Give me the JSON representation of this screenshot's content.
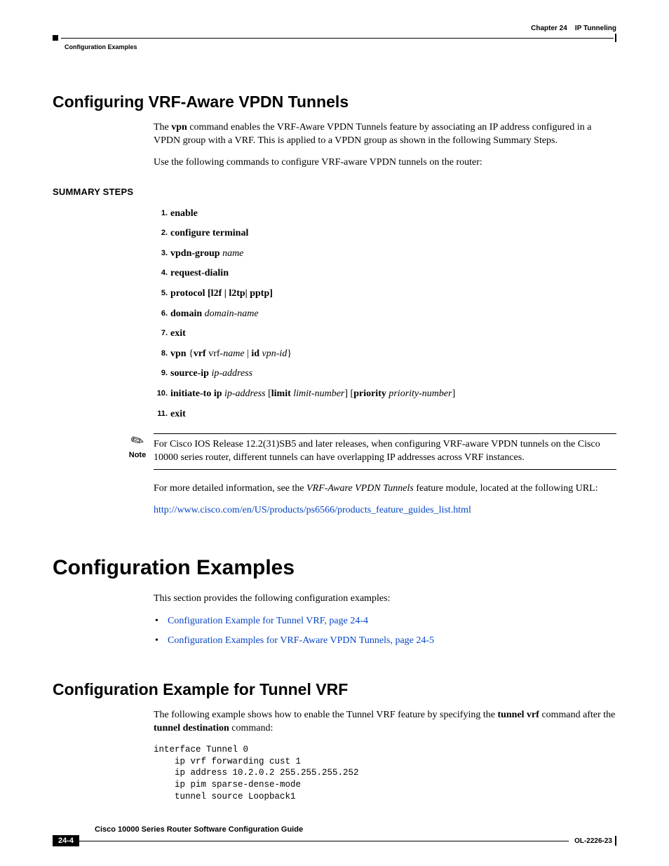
{
  "header": {
    "chapter_label": "Chapter 24",
    "chapter_title": "IP Tunneling",
    "section": "Configuration Examples"
  },
  "section1": {
    "title": "Configuring VRF-Aware VPDN Tunnels",
    "para1_pre": "The ",
    "para1_b1": "vpn",
    "para1_post": " command enables the VRF-Aware VPDN Tunnels feature by associating an IP address configured in a VPDN group with a VRF. This is applied to a VPDN group as shown in the following Summary Steps.",
    "para2": "Use the following commands to configure VRF-aware VPDN tunnels on the router:",
    "summary_heading": "SUMMARY STEPS",
    "steps": {
      "s1": "enable",
      "s2": "configure terminal",
      "s3_b": "vpdn-group",
      "s3_i": "name",
      "s4": "request-dialin",
      "s5_b": "protocol",
      "s5_rest": "[l2f | l2tp| pptp]",
      "s6_b": "domain",
      "s6_i": "domain-name",
      "s7": "exit",
      "s8_b1": "vpn",
      "s8_b2": "vrf",
      "s8_i1": "name",
      "s8_b3": "id",
      "s8_i2": "vpn-id",
      "s9_b": "source-ip",
      "s9_i": "ip-address",
      "s10_b1": "initiate-to ip",
      "s10_i1": "ip-address",
      "s10_b2": "limit",
      "s10_i2": "limit-number",
      "s10_b3": "priority",
      "s10_i3": "priority-number",
      "s11": "exit"
    },
    "note_label": "Note",
    "note_text": "For Cisco IOS Release 12.2(31)SB5 and later releases, when configuring VRF-aware VPDN tunnels on the Cisco 10000 series router, different tunnels can have overlapping IP addresses across VRF instances.",
    "para3_pre": "For more detailed information, see the ",
    "para3_i": "VRF-Aware VPDN Tunnels",
    "para3_post": " feature module, located at the following URL:",
    "link": "http://www.cisco.com/en/US/products/ps6566/products_feature_guides_list.html"
  },
  "section2": {
    "title": "Configuration Examples",
    "intro": "This section provides the following configuration examples:",
    "bullet1": "Configuration Example for Tunnel VRF, page 24-4",
    "bullet2": "Configuration Examples for VRF-Aware VPDN Tunnels, page 24-5"
  },
  "section3": {
    "title": "Configuration Example for Tunnel VRF",
    "para_pre": "The following example shows how to enable the Tunnel VRF feature by specifying the ",
    "para_b1": "tunnel vrf",
    "para_mid": " command after the ",
    "para_b2": "tunnel destination",
    "para_post": " command:",
    "code": "interface Tunnel 0\n    ip vrf forwarding cust 1\n    ip address 10.2.0.2 255.255.255.252\n    ip pim sparse-dense-mode\n    tunnel source Loopback1"
  },
  "footer": {
    "guide": "Cisco 10000 Series Router Software Configuration Guide",
    "page": "24-4",
    "doc": "OL-2226-23"
  }
}
